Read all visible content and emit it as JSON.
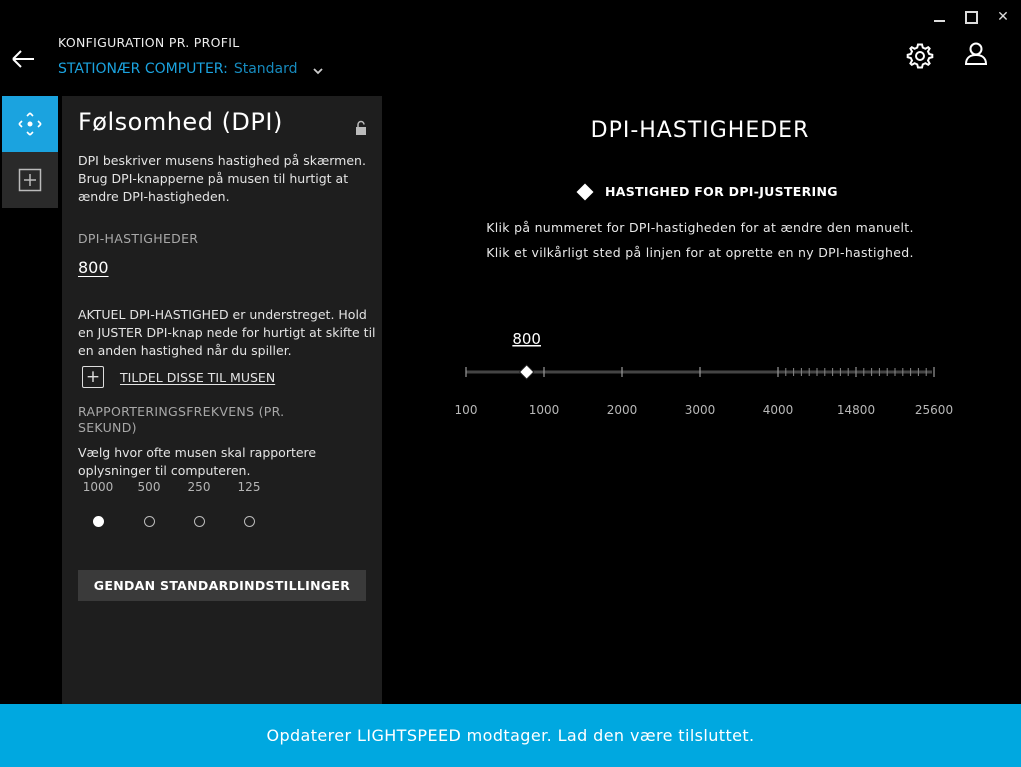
{
  "window": {
    "close_glyph": "✕"
  },
  "header": {
    "title": "KONFIGURATION PR. PROFIL",
    "profile_device": "STATIONÆR COMPUTER:",
    "profile_name": "Standard"
  },
  "panel": {
    "title": "Følsomhed (DPI)",
    "description": "DPI beskriver musens hastighed på skærmen. Brug DPI-knapperne på musen til hurtigt at ændre DPI-hastigheden.",
    "dpi_label": "DPI-HASTIGHEDER",
    "dpi_value": "800",
    "current_text": "AKTUEL DPI-HASTIGHED er understreget. Hold en JUSTER DPI-knap nede for hurtigt at skifte til en anden hastighed når du spiller.",
    "assign_link": "TILDEL DISSE TIL MUSEN",
    "report_label": "RAPPORTERINGSFREKVENS (PR. SEKUND)",
    "report_desc": "Vælg hvor ofte musen skal rapportere oplysninger til computeren.",
    "rates": [
      {
        "label": "1000",
        "selected": true
      },
      {
        "label": "500",
        "selected": false
      },
      {
        "label": "250",
        "selected": false
      },
      {
        "label": "125",
        "selected": false
      }
    ],
    "reset_button": "GENDAN STANDARDINDSTILLINGER"
  },
  "main": {
    "title": "DPI-HASTIGHEDER",
    "shift_legend": "HASTIGHED FOR DPI-JUSTERING",
    "help_line1": "Klik på nummeret for DPI-hastigheden for at ændre den manuelt.",
    "help_line2": "Klik et vilkårligt sted på linjen for at oprette en ny DPI-hastighed."
  },
  "slider": {
    "current_dpi": 800,
    "current_label": "800",
    "tick_labels": [
      "100",
      "1000",
      "2000",
      "3000",
      "4000",
      "14800",
      "25600"
    ]
  },
  "status_bar": {
    "message": "Opdaterer LIGHTSPEED modtager. Lad den være tilsluttet."
  },
  "colors": {
    "accent": "#1ba3df",
    "status_bar": "#00a8e0",
    "panel": "#1e1e1e"
  }
}
